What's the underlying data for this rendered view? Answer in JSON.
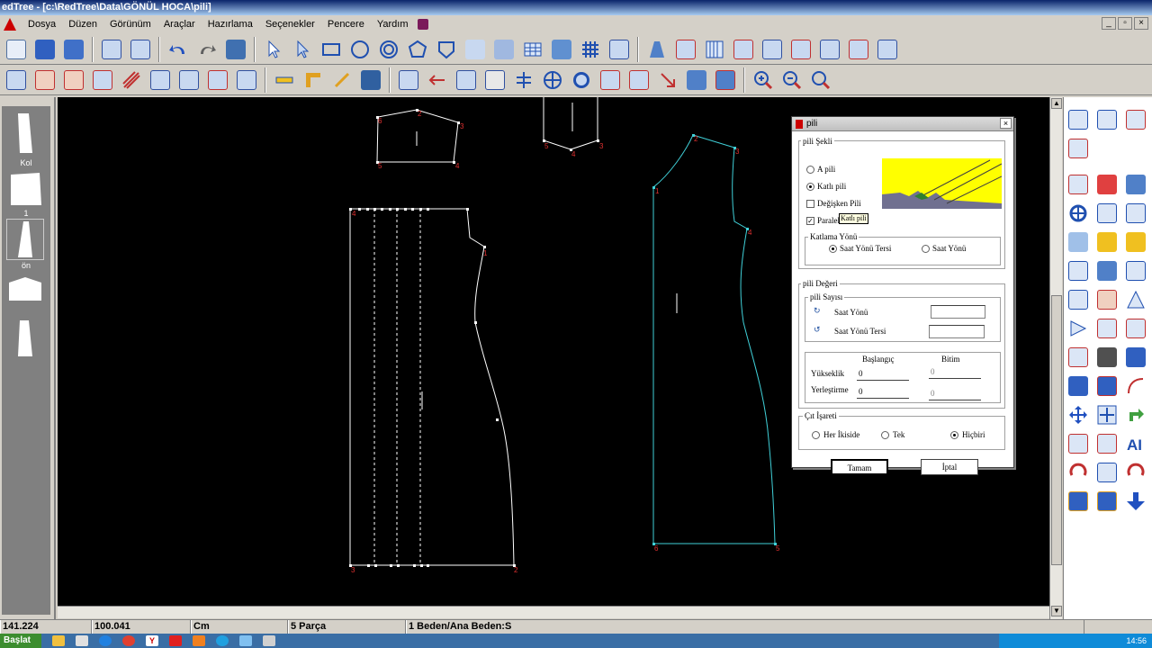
{
  "window": {
    "title": "edTree - [c:\\RedTree\\Data\\GÖNÜL HOCA\\pili]"
  },
  "menu": {
    "items": [
      "Dosya",
      "Düzen",
      "Görünüm",
      "Araçlar",
      "Hazırlama",
      "Seçenekler",
      "Pencere",
      "Yardım"
    ]
  },
  "left_panel": {
    "labels": [
      "Kol",
      "1",
      "ön"
    ]
  },
  "canvas": {
    "pieces": {
      "sleeve_labels": [
        "2",
        "3",
        "4",
        "5",
        "6"
      ],
      "front_labels": [
        "4",
        "1",
        "2",
        "3"
      ],
      "back_labels": [
        "1",
        "2",
        "3",
        "4",
        "5",
        "6"
      ],
      "neck_labels": [
        "5",
        "4",
        "3"
      ]
    }
  },
  "dialog": {
    "title": "pili",
    "shape_group": "pili Şekli",
    "opt_a": "A pili",
    "opt_katli": "Katlı pili",
    "chk_degisken": "Değişken Pili",
    "chk_paralel": "Paralel",
    "tooltip": "Katlı pili",
    "fold_group": "Katlama Yönü",
    "fold_ccw": "Saat Yönü Tersi",
    "fold_cw": "Saat Yönü",
    "value_group": "pili Değeri",
    "count_group": "pili Sayısı",
    "count_cw": "Saat Yönü",
    "count_ccw": "Saat Yönü Tersi",
    "col_start": "Başlangıç",
    "col_end": "Bitim",
    "row_height": "Yükseklik",
    "row_place": "Yerleştirme",
    "height_start": "0",
    "height_end": "0",
    "place_start": "0",
    "place_end": "0",
    "notch_group": "Çıt İşareti",
    "notch_both": "Her İkiside",
    "notch_single": "Tek",
    "notch_none": "Hiçbiri",
    "ok": "Tamam",
    "cancel": "İptal"
  },
  "status": {
    "x": "141.224",
    "y": "100.041",
    "unit": "Cm",
    "pieces": "5 Parça",
    "size": "1 Beden/Ana Beden:S"
  },
  "taskbar": {
    "start": "Başlat",
    "clock": "14:56"
  }
}
